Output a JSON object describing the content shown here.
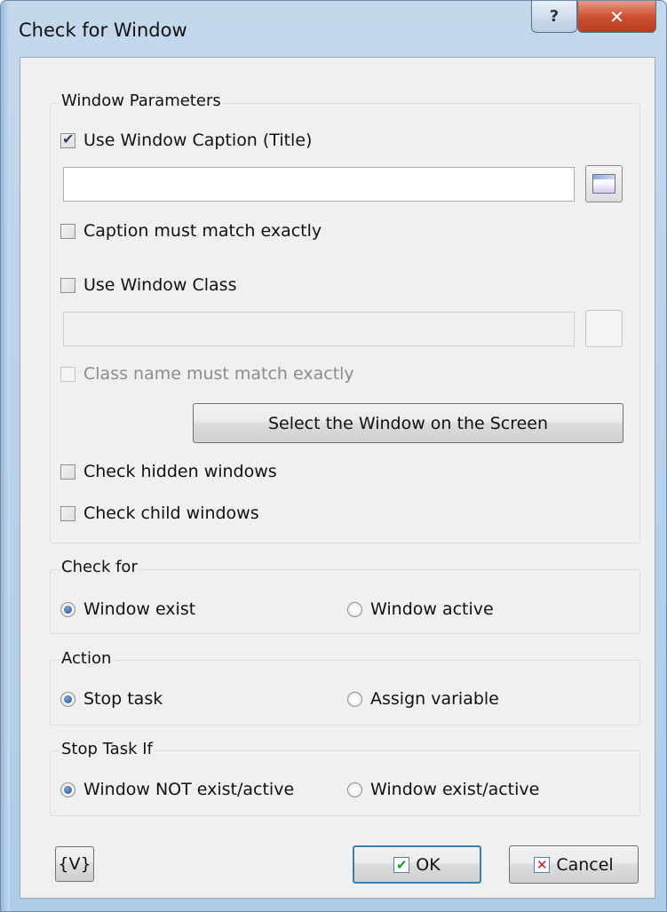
{
  "window": {
    "title": "Check for Window",
    "help_label": "?",
    "close_label": "✕"
  },
  "window_parameters": {
    "legend": "Window Parameters",
    "use_caption_label": "Use Window Caption (Title)",
    "caption_value": "",
    "caption_exact_label": "Caption must match exactly",
    "use_class_label": "Use Window Class",
    "class_value": "",
    "class_exact_label": "Class name must match exactly",
    "select_window_button": "Select the Window on the Screen",
    "check_hidden_label": "Check hidden windows",
    "check_child_label": "Check child windows"
  },
  "check_for": {
    "legend": "Check for",
    "option_exist": "Window exist",
    "option_active": "Window active",
    "selected": "Window exist"
  },
  "action": {
    "legend": "Action",
    "option_stop": "Stop task",
    "option_assign": "Assign variable",
    "selected": "Stop task"
  },
  "stop_task_if": {
    "legend": "Stop Task If",
    "option_not_exist": "Window NOT exist/active",
    "option_exist": "Window exist/active",
    "selected": "Window NOT exist/active"
  },
  "footer": {
    "variables_button": "{V}",
    "ok_button": "OK",
    "cancel_button": "Cancel"
  }
}
